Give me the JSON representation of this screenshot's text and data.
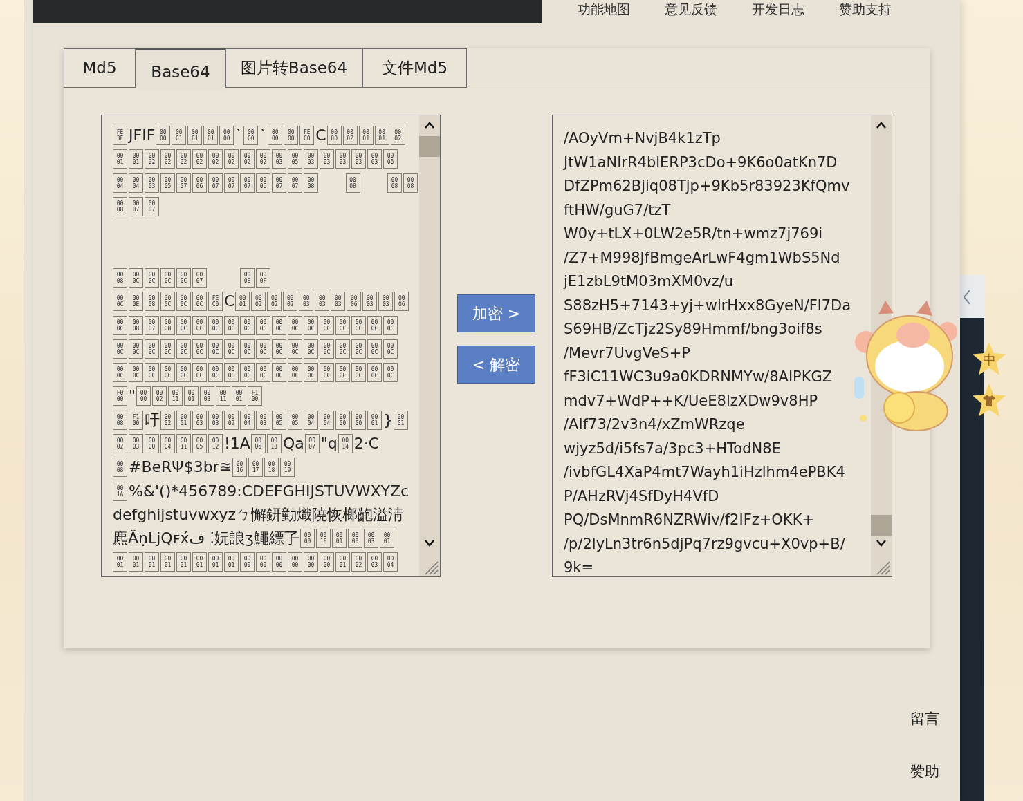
{
  "top_nav": [
    "功能地图",
    "意见反馈",
    "开发日志",
    "赞助支持"
  ],
  "tabs": [
    {
      "label": "Md5",
      "selected": false
    },
    {
      "label": "Base64",
      "selected": true
    },
    {
      "label": "图片转Base64",
      "selected": false
    },
    {
      "label": "文件Md5",
      "selected": false
    }
  ],
  "input_box": {
    "lines": [
      [
        {
          "kind": "codes",
          "codes": [
            "FE3F"
          ]
        },
        {
          "kind": "text",
          "text": "JFIF"
        },
        {
          "kind": "codes",
          "codes": [
            "0000",
            "0001",
            "0001",
            "0001",
            "0000"
          ]
        },
        {
          "kind": "text",
          "text": "`"
        },
        {
          "kind": "codes",
          "codes": [
            "0000"
          ]
        },
        {
          "kind": "text",
          "text": "`"
        },
        {
          "kind": "codes",
          "codes": [
            "0000",
            "0000",
            "FEC0"
          ]
        },
        {
          "kind": "text",
          "text": "C"
        },
        {
          "kind": "codes",
          "codes": [
            "0000",
            "0002",
            "0001",
            "0001",
            "0002"
          ]
        }
      ],
      [
        {
          "kind": "codes",
          "codes": [
            "0001",
            "0001",
            "0002",
            "0002",
            "0002",
            "0002",
            "0002",
            "0002",
            "0002",
            "0002",
            "0003",
            "0005",
            "0003",
            "0003",
            "0003",
            "0003",
            "0003",
            "0006"
          ]
        }
      ],
      [
        {
          "kind": "codes",
          "codes": [
            "0004",
            "0004",
            "0003",
            "0005",
            "0007",
            "0006",
            "0007",
            "0007",
            "0007",
            "0006",
            "0007",
            "0007",
            "0008"
          ]
        },
        {
          "kind": "gap"
        },
        {
          "kind": "codes",
          "codes": [
            "0008"
          ]
        },
        {
          "kind": "gap"
        },
        {
          "kind": "codes",
          "codes": [
            "0008",
            "0008"
          ]
        }
      ],
      [
        {
          "kind": "codes",
          "codes": [
            "0008",
            "0007",
            "0007"
          ]
        }
      ],
      [
        {
          "kind": "gap"
        }
      ],
      [
        {
          "kind": "gap"
        }
      ],
      [
        {
          "kind": "codes",
          "codes": [
            "0008",
            "000C",
            "000C",
            "000C",
            "000C",
            "0007"
          ]
        },
        {
          "kind": "gap"
        },
        {
          "kind": "codes",
          "codes": [
            "000E",
            "000F"
          ]
        }
      ],
      [
        {
          "kind": "codes",
          "codes": [
            "000C",
            "000E",
            "0008",
            "000C",
            "000C",
            "000C",
            "FEC0"
          ]
        },
        {
          "kind": "text",
          "text": "C"
        },
        {
          "kind": "codes",
          "codes": [
            "0001",
            "0002",
            "0002",
            "0002",
            "0003",
            "0003",
            "0003",
            "0006",
            "0003",
            "0003",
            "0006"
          ]
        }
      ],
      [
        {
          "kind": "codes",
          "codes": [
            "000C",
            "0008",
            "0007",
            "0008",
            "000C",
            "000C",
            "000C",
            "000C",
            "000C",
            "000C",
            "000C",
            "000C",
            "000C",
            "000C",
            "000C",
            "000C",
            "000C",
            "000C"
          ]
        }
      ],
      [
        {
          "kind": "codes",
          "codes": [
            "000C",
            "000C",
            "000C",
            "000C",
            "000C",
            "000C",
            "000C",
            "000C",
            "000C",
            "000C",
            "000C",
            "000C",
            "000C",
            "000C",
            "000C",
            "000C",
            "000C",
            "000C"
          ]
        }
      ],
      [
        {
          "kind": "codes",
          "codes": [
            "000C",
            "000C",
            "000C",
            "000C",
            "000C",
            "000C",
            "000C",
            "000C",
            "000C",
            "000C",
            "000C",
            "000C",
            "000C",
            "000C",
            "000C",
            "000C",
            "000C",
            "000C"
          ]
        }
      ],
      [
        {
          "kind": "codes",
          "codes": [
            "F000"
          ]
        },
        {
          "kind": "text",
          "text": "\""
        },
        {
          "kind": "codes",
          "codes": [
            "0000",
            "0002",
            "0011",
            "0001",
            "0003",
            "0011",
            "0001",
            "F100"
          ]
        }
      ],
      [
        {
          "kind": "codes",
          "codes": [
            "0008",
            "F100"
          ]
        },
        {
          "kind": "text",
          "text": "吁"
        },
        {
          "kind": "codes",
          "codes": [
            "0002",
            "0001",
            "0003",
            "0003",
            "0002",
            "0004",
            "0003",
            "0005",
            "0005",
            "0004",
            "0004",
            "0000",
            "0000",
            "0001"
          ]
        },
        {
          "kind": "text",
          "text": "}"
        },
        {
          "kind": "codes",
          "codes": [
            "0001"
          ]
        }
      ],
      [
        {
          "kind": "codes",
          "codes": [
            "0002",
            "0003",
            "0000",
            "0004",
            "0011",
            "0005",
            "0012"
          ]
        },
        {
          "kind": "text",
          "text": "!1A"
        },
        {
          "kind": "codes",
          "codes": [
            "0006",
            "0013"
          ]
        },
        {
          "kind": "text",
          "text": "Qa"
        },
        {
          "kind": "codes",
          "codes": [
            "0007"
          ]
        },
        {
          "kind": "text",
          "text": "\"q"
        },
        {
          "kind": "codes",
          "codes": [
            "0014"
          ]
        },
        {
          "kind": "text",
          "text": "2·C"
        }
      ],
      [
        {
          "kind": "codes",
          "codes": [
            "0008"
          ]
        },
        {
          "kind": "text",
          "text": "#BeRΨ$3br≊"
        },
        {
          "kind": "codes",
          "codes": [
            "0016",
            "0017",
            "0018",
            "0019"
          ]
        }
      ],
      [
        {
          "kind": "codes",
          "codes": [
            "001A"
          ]
        },
        {
          "kind": "text",
          "text": "%&'()*456789:CDEFGHIJSTUVWXYZc"
        }
      ],
      [
        {
          "kind": "text",
          "text": "defghijstuvwxyzㄅ懈鈃勭熾隢恢榔齙溢淸"
        }
      ],
      [
        {
          "kind": "text",
          "text": "麃ÄṇLjԚꜰx́ف ⁚妧誏ʒ鱦縹孒"
        },
        {
          "kind": "codes",
          "codes": [
            "0000",
            "001F",
            "0001",
            "0000",
            "0003",
            "0001"
          ]
        }
      ],
      [
        {
          "kind": "codes",
          "codes": [
            "0001",
            "0001",
            "0001",
            "0001",
            "0001",
            "0001",
            "0001",
            "0001",
            "0000",
            "0000",
            "0000",
            "0000",
            "0000",
            "0000",
            "0001",
            "0002",
            "0003",
            "0004"
          ]
        }
      ]
    ]
  },
  "buttons": [
    {
      "label": "加密 >"
    },
    {
      "label": "< 解密"
    }
  ],
  "output_box": {
    "lines": [
      "/AOyVm+NvjB4k1zTp",
      "JtW1aNIrR4blERP3cDo+9K6o0atKn7D",
      "DfZPm62Bjiq08Tjp+9Kb5r83923KfQmv",
      "ftHW/guG7/tzT",
      "W0y+tLX+0LW2e5R/tn+wmz7j769i",
      "/Z7+M998JfBmgeArLwF4gm1WbS5Nd",
      "jE1zbL9tM03mXM0vz/u",
      "S88zH5+7143+yj+wlrHxx8GyeN/Fl7Da",
      "S69HB/ZcTjz2Sy89Hmmf/bng3oif8s",
      "/Mevr7UvgVeS+P",
      "fF3iC11WC3u9a0KDRNMYw/8AIPKGZ",
      "mdv7+WdP++K/UeE8lzXDw9v8HP",
      "/AIf73/2v3n4/xZmWRzqe",
      "wjyz5d/i5fs7a/3pc3+HTodN8E",
      "/ivbfGL4XaP4mt7Wayh1iHzlhm4ePBK4",
      "P/AHzRVj4SfDyH4VfD",
      "PQ/DsMnmR6NZRWiv/f2IFz+OKK+",
      "/p/2lyLn3tr6n5djPq7rz9gvcu+X0vp+B/",
      "9k="
    ]
  },
  "widget": {
    "badge": "中"
  },
  "side_links": [
    "留言",
    "赞助"
  ]
}
